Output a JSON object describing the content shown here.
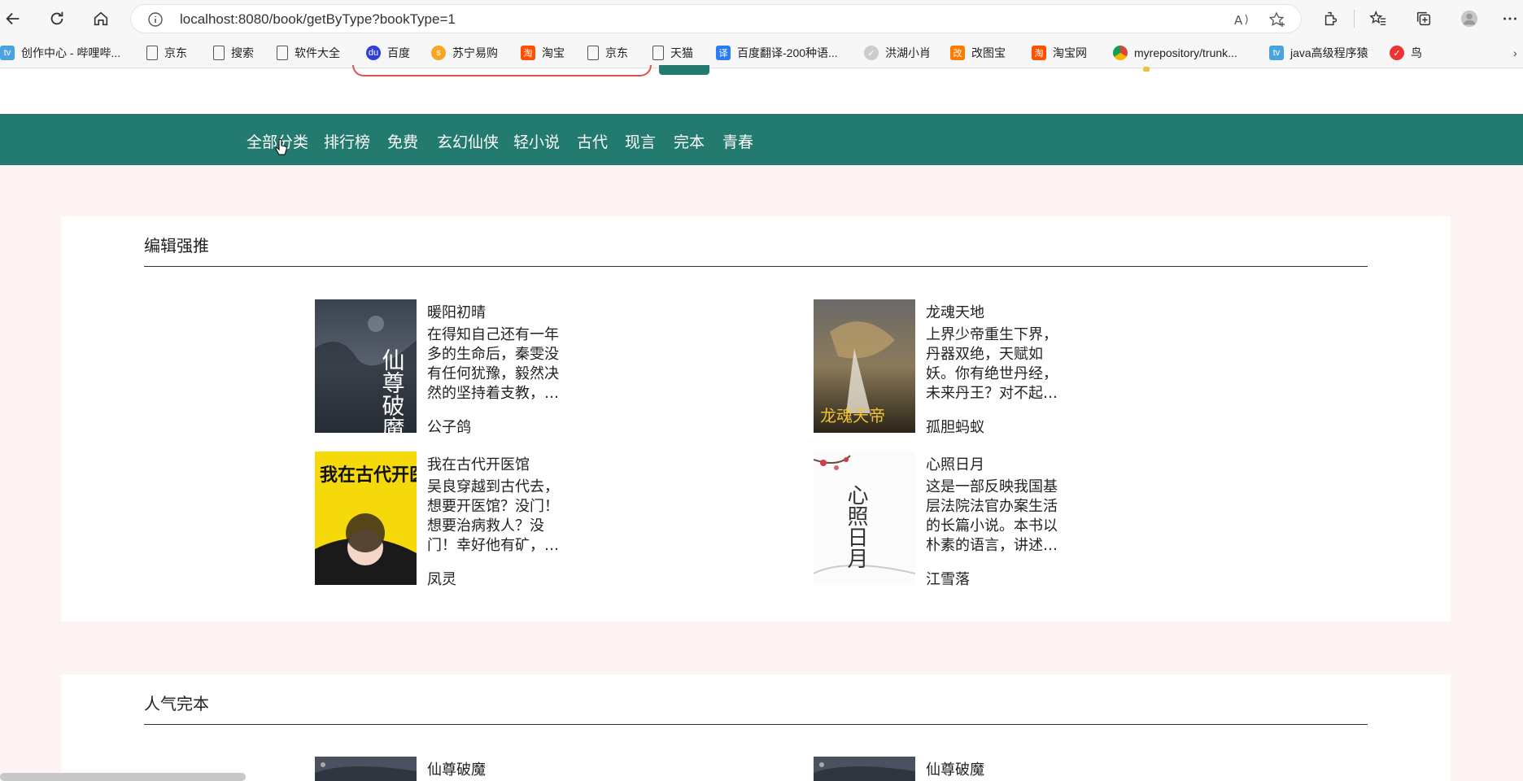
{
  "browser": {
    "url": "localhost:8080/book/getByType?bookType=1",
    "bookmarks": [
      {
        "label": "创作中心 - 哔哩哔...",
        "icon": "bilibili-icon"
      },
      {
        "label": "京东",
        "icon": "page-icon"
      },
      {
        "label": "搜索",
        "icon": "page-icon"
      },
      {
        "label": "软件大全",
        "icon": "page-icon"
      },
      {
        "label": "百度",
        "icon": "baidu-icon"
      },
      {
        "label": "苏宁易购",
        "icon": "suning-icon"
      },
      {
        "label": "淘宝",
        "icon": "taobao-icon"
      },
      {
        "label": "京东",
        "icon": "page-icon"
      },
      {
        "label": "天猫",
        "icon": "page-icon"
      },
      {
        "label": "百度翻译-200种语...",
        "icon": "translate-icon"
      },
      {
        "label": "洪湖小肖",
        "icon": "bird-icon"
      },
      {
        "label": "改图宝",
        "icon": "gaitubao-icon"
      },
      {
        "label": "淘宝网",
        "icon": "taobao-icon"
      },
      {
        "label": "myrepository/trunk...",
        "icon": "chrome-icon"
      },
      {
        "label": "java高级程序猿",
        "icon": "bilibili-icon"
      },
      {
        "label": "鸟",
        "icon": "bird-icon"
      }
    ]
  },
  "nav": {
    "items": [
      "全部分类",
      "排行榜",
      "免费",
      "玄幻仙侠",
      "轻小说",
      "古代",
      "现言",
      "完本",
      "青春"
    ]
  },
  "sections": [
    {
      "title": "编辑强推",
      "books": [
        {
          "title": "暖阳初晴",
          "desc": "在得知自己还有一年多的生命后，秦雯没有任何犹豫，毅然决然的坚持着支教，将自己的...",
          "author": "公子鸽",
          "cover": "仙尊破魔"
        },
        {
          "title": "龙魂天地",
          "desc": "上界少帝重生下界，丹器双绝，天赋如妖。你有绝世丹经，未来丹王？对不起，那是我...",
          "author": "孤胆蚂蚁",
          "cover": "龙魂天帝"
        },
        {
          "title": "我在古代开医馆",
          "desc": "吴良穿越到古代去，想要开医馆？没门！想要治病救人？没门！幸好他有矿，有技术有钱...",
          "author": "凤灵",
          "cover": "我在古代开医馆"
        },
        {
          "title": "心照日月",
          "desc": "这是一部反映我国基层法院法官办案生活的长篇小说。本书以朴素的语言，讲述了一群基...",
          "author": "江雪落",
          "cover": "心照日月"
        }
      ]
    },
    {
      "title": "人气完本",
      "books": [
        {
          "title": "仙尊破魔",
          "cover": "仙尊破魔"
        },
        {
          "title": "仙尊破魔",
          "cover": "仙尊破魔"
        }
      ]
    }
  ]
}
